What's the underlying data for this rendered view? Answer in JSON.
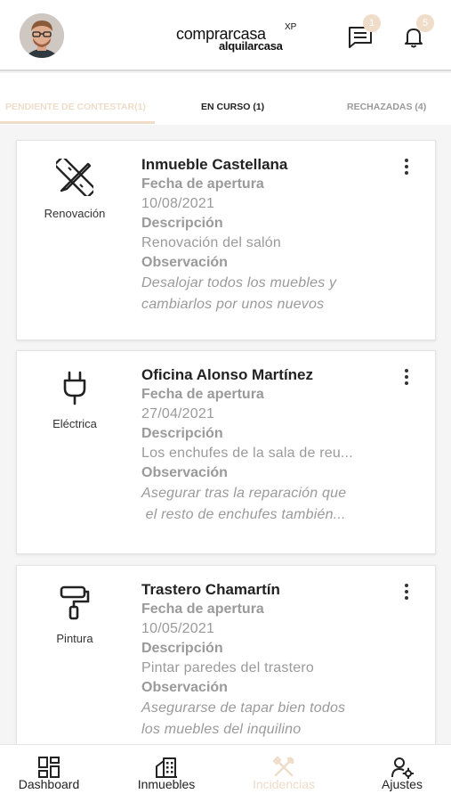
{
  "header": {
    "logo_top": "comprarcasa",
    "logo_xp": "XP",
    "logo_bottom": "alquilarcasa",
    "messages_badge": "1",
    "notifications_badge": "5"
  },
  "tabs": [
    {
      "label": "PENDIENTE DE CONTESTAR(1)",
      "active": true
    },
    {
      "label": "EN CURSO (1)",
      "active": false
    },
    {
      "label": "RECHAZADAS (4)",
      "active": false
    }
  ],
  "cards": [
    {
      "category": "Renovación",
      "category_icon": "pencil-ruler-icon",
      "title": "Inmueble Castellana",
      "fecha_label": "Fecha de apertura",
      "fecha": "10/08/2021",
      "desc_label": "Descripción",
      "desc": "Renovación del salón",
      "obs_label": "Observación",
      "obs_line1": "Desalojar todos los muebles y",
      "obs_line2": "cambiarlos por unos nuevos"
    },
    {
      "category": "Eléctrica",
      "category_icon": "plug-icon",
      "title": "Oficina Alonso Martínez",
      "fecha_label": "Fecha de apertura",
      "fecha": "27/04/2021",
      "desc_label": "Descripción",
      "desc": "Los enchufes de la sala de reu...",
      "obs_label": "Observación",
      "obs_line1": "Asegurar tras la reparación que",
      "obs_line2": " el resto de enchufes también..."
    },
    {
      "category": "Pintura",
      "category_icon": "paint-roller-icon",
      "title": "Trastero Chamartín",
      "fecha_label": "Fecha de apertura",
      "fecha": "10/05/2021",
      "desc_label": "Descripción",
      "desc": "Pintar paredes del trastero",
      "obs_label": "Observación",
      "obs_line1": "Asegurarse de tapar bien todos",
      "obs_line2": "los muebles del inquilino"
    }
  ],
  "bottom_nav": [
    {
      "label": "Dashboard",
      "icon": "dashboard-icon",
      "active": false
    },
    {
      "label": "Inmuebles",
      "icon": "building-icon",
      "active": false
    },
    {
      "label": "Incidencias",
      "icon": "tools-icon",
      "active": true
    },
    {
      "label": "Ajustes",
      "icon": "user-settings-icon",
      "active": false
    }
  ],
  "colors": {
    "accent": "#efdcc9",
    "text_muted": "#9a9a9a",
    "text_dark": "#222222"
  }
}
